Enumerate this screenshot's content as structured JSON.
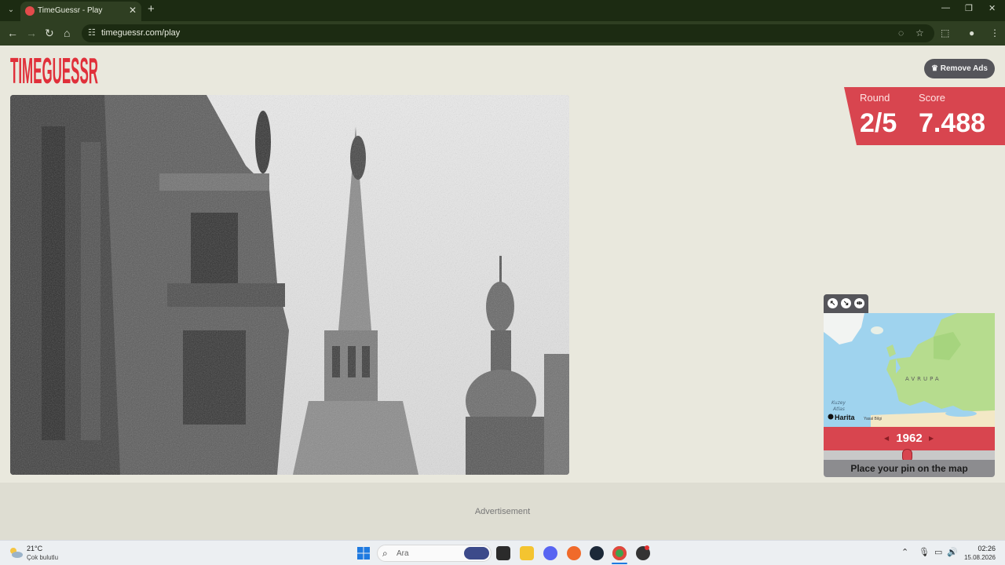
{
  "browser": {
    "tab_title": "TimeGuessr - Play",
    "url": "timeguessr.com/play",
    "new_tab": "+",
    "tab_close": "✕",
    "controls": {
      "minimize": "—",
      "restore": "❐",
      "close": "✕"
    },
    "nav": {
      "back": "←",
      "forward": "→",
      "reload": "↻",
      "home": "⌂"
    }
  },
  "page": {
    "logo_text": "TIMEGUESSR",
    "remove_ads_label": "Remove Ads",
    "round_label": "Round",
    "round_value": "2/5",
    "score_label": "Score",
    "score_value": "7.488",
    "map": {
      "region_label": "AVRUPA",
      "sea_label_1": "Kuzey",
      "sea_label_2": "Atlas",
      "attribution_logo": "Harita",
      "legal_label": "Yasal Bilgi"
    },
    "year": "1962",
    "year_prev_arrow": "◀",
    "year_next_arrow": "▶",
    "year_slider_fraction": 0.49,
    "place_pin_label": "Place your pin on the map",
    "ad_label": "Advertisement",
    "colors": {
      "accent_red": "#d8454f",
      "logo_red": "#e0303a",
      "page_bg": "#e9e8dd"
    }
  },
  "taskbar": {
    "weather_temp": "21°C",
    "weather_desc": "Çok bulutlu",
    "search_placeholder": "Ara",
    "clock_time": "02:26",
    "clock_date": "15.08.2026"
  }
}
